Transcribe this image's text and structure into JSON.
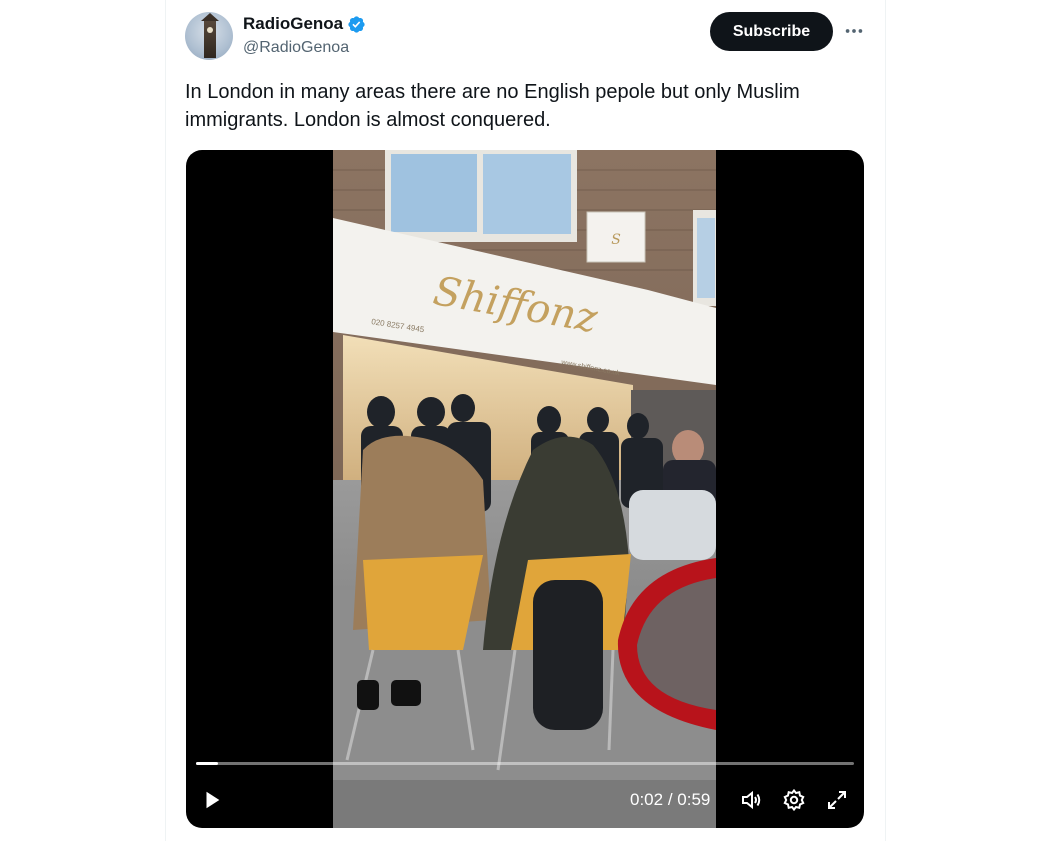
{
  "author": {
    "display_name": "RadioGenoa",
    "handle": "@RadioGenoa",
    "verified": true,
    "verified_color": "#1d9bf0"
  },
  "actions": {
    "subscribe_label": "Subscribe",
    "more_icon": "more-horizontal-icon"
  },
  "tweet": {
    "text": "In London in many areas there are no English pepole but only Muslim immigrants. London is almost conquered."
  },
  "video": {
    "current_time": "0:02",
    "separator": "/",
    "duration": "0:59",
    "progress_fraction": 0.034,
    "icons": [
      "play-icon",
      "volume-icon",
      "settings-icon",
      "fullscreen-icon"
    ],
    "shop_sign": "Shiffonz",
    "shop_phone": "020 8257 4945",
    "shop_url": "www.shiffonz.co.uk"
  },
  "colors": {
    "text_primary": "#0f1419",
    "text_secondary": "#536471",
    "button_dark": "#0f1419",
    "media_bg": "#000000"
  }
}
